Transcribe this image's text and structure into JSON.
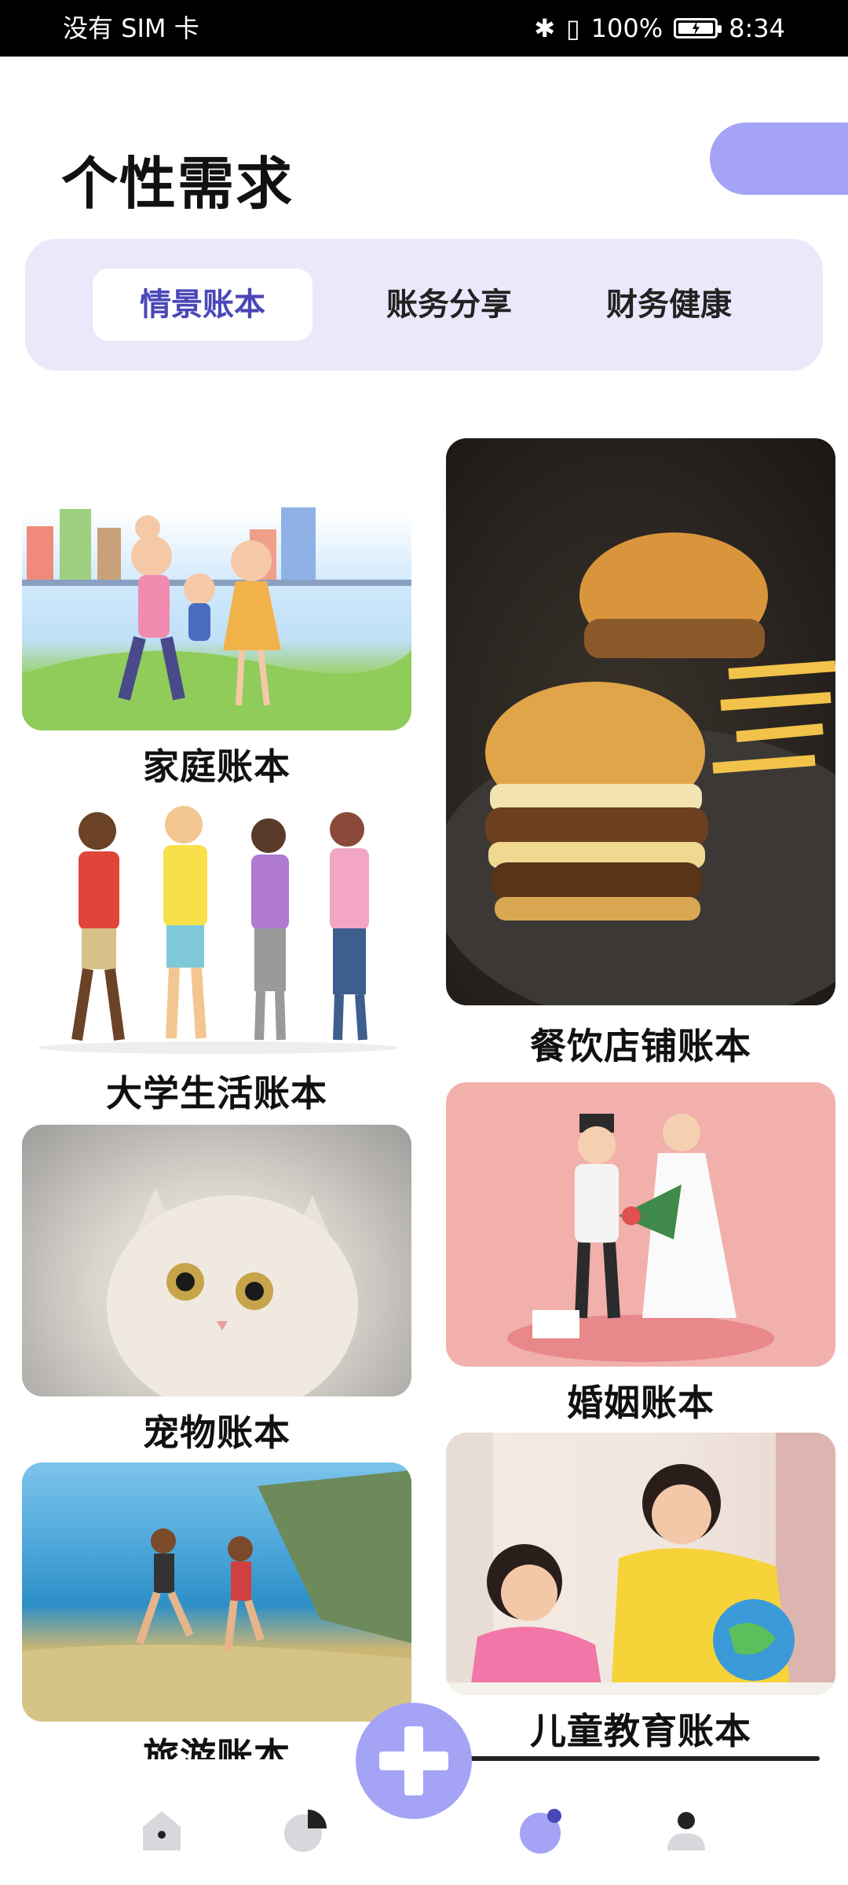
{
  "status_bar": {
    "carrier": "没有 SIM 卡",
    "battery": "100%",
    "time": "8:34"
  },
  "page": {
    "title": "个性需求"
  },
  "tabs": [
    {
      "label": "情景账本",
      "active": true
    },
    {
      "label": "账务分享",
      "active": false
    },
    {
      "label": "财务健康",
      "active": false
    }
  ],
  "cards": {
    "family": "家庭账本",
    "college": "大学生活账本",
    "pet": "宠物账本",
    "travel": "旅游账本",
    "restaurant": "餐饮店铺账本",
    "marriage": "婚姻账本",
    "children": "儿童教育账本"
  },
  "bottom_nav": {
    "items": [
      {
        "icon": "home-icon"
      },
      {
        "icon": "chart-icon"
      },
      {
        "icon": "add-icon"
      },
      {
        "icon": "discover-icon",
        "active": true
      },
      {
        "icon": "profile-icon"
      }
    ]
  },
  "colors": {
    "accent": "#a4a3f6",
    "tab_bg": "#e9e9fb",
    "active_tab_text": "#4a47b8"
  }
}
